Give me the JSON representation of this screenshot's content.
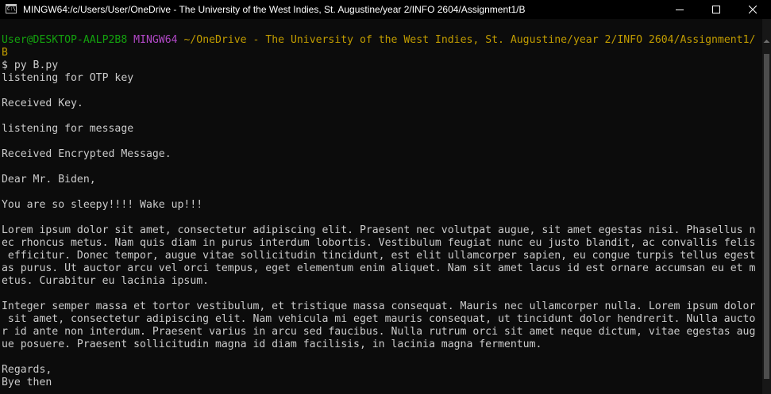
{
  "window": {
    "title": "MINGW64:/c/Users/User/OneDrive - The University of the West Indies, St. Augustine/year 2/INFO 2604/Assignment1/B",
    "icon": "terminal-icon",
    "controls": [
      "minimize-icon",
      "maximize-icon",
      "close-icon"
    ]
  },
  "colors": {
    "background": "#0c0c0c",
    "text": "#cccccc",
    "user_host": "#13a10e",
    "msystem": "#b148c6",
    "path": "#c19c00"
  },
  "prompt": {
    "user_host": "User@DESKTOP-AALP2B8",
    "msystem": "MINGW64",
    "path": "~/OneDrive - The University of the West Indies, St. Augustine/year 2/INFO 2604/Assignment1/",
    "path_wrap": "B",
    "command": "$ py B.py"
  },
  "output": [
    "listening for OTP key",
    "",
    "Received Key.",
    "",
    "listening for message",
    "",
    "Received Encrypted Message.",
    "",
    "Dear Mr. Biden,",
    "",
    "You are so sleepy!!!! Wake up!!!",
    "",
    "Lorem ipsum dolor sit amet, consectetur adipiscing elit. Praesent nec volutpat augue, sit amet egestas nisi. Phasellus n",
    "ec rhoncus metus. Nam quis diam in purus interdum lobortis. Vestibulum feugiat nunc eu justo blandit, ac convallis felis",
    " efficitur. Donec tempor, augue vitae sollicitudin tincidunt, est elit ullamcorper sapien, eu congue turpis tellus egest",
    "as purus. Ut auctor arcu vel orci tempus, eget elementum enim aliquet. Nam sit amet lacus id est ornare accumsan eu et m",
    "etus. Curabitur eu lacinia ipsum.",
    "",
    "Integer semper massa et tortor vestibulum, et tristique massa consequat. Mauris nec ullamcorper nulla. Lorem ipsum dolor",
    " sit amet, consectetur adipiscing elit. Nam vehicula mi eget mauris consequat, ut tincidunt dolor hendrerit. Nulla aucto",
    "r id ante non interdum. Praesent varius in arcu sed faucibus. Nulla rutrum orci sit amet neque dictum, vitae egestas aug",
    "ue posuere. Praesent sollicitudin magna id diam facilisis, in lacinia magna fermentum.",
    "",
    "Regards,",
    "Bye then"
  ]
}
